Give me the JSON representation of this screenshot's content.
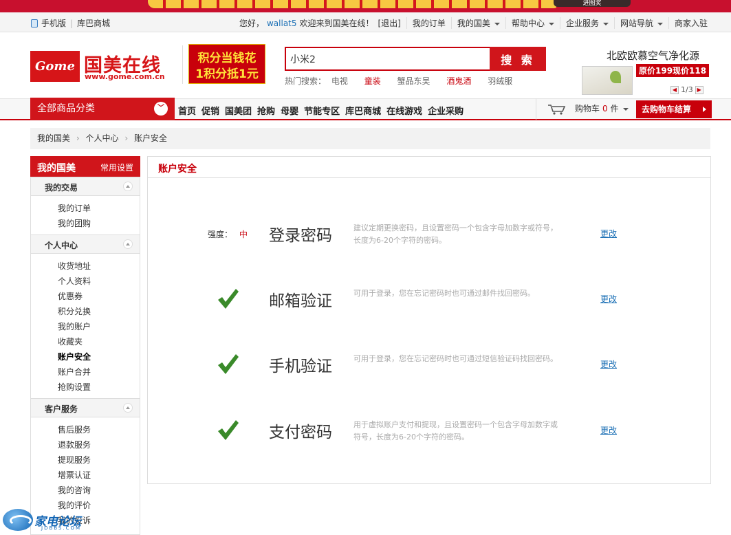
{
  "banner": {
    "button_label": "进图奖"
  },
  "topbar": {
    "mobile": "手机版",
    "coo8": "库巴商城",
    "greeting": "您好，",
    "username": "wallat5",
    "welcome": "欢迎来到国美在线！",
    "logout": "[退出]",
    "orders": "我的订单",
    "my_gome": "我的国美",
    "help": "帮助中心",
    "enterprise": "企业服务",
    "site_nav": "网站导航",
    "merchant": "商家入驻"
  },
  "header": {
    "logo_mark": "Gome",
    "logo_name": "国美在线",
    "logo_url": "www.gome.com.cn",
    "promo_line1": "积分当钱花",
    "promo_line2": "1积分抵1元",
    "search_value": "小米2",
    "search_button": "搜 索",
    "hot_label": "热门搜索：",
    "hot_terms": [
      "电视",
      "童装",
      "蟹品东吴",
      "酒鬼酒",
      "羽绒服"
    ],
    "ad_title": "北欧欧慕空气净化源",
    "ad_price": "原价199现价118",
    "ad_pager": "1/3"
  },
  "nav": {
    "all_categories": "全部商品分类",
    "links": [
      "首页",
      "促销",
      "国美团",
      "抢购",
      "母婴",
      "节能专区",
      "库巴商城",
      "在线游戏",
      "企业采购"
    ],
    "cart_label": "购物车",
    "cart_count": "0",
    "cart_unit": "件",
    "checkout": "去购物车结算"
  },
  "breadcrumb": [
    "我的国美",
    "个人中心",
    "账户安全"
  ],
  "sidebar": {
    "title": "我的国美",
    "settings": "常用设置",
    "groups": [
      {
        "title": "我的交易",
        "items": [
          "我的订单",
          "我的团购"
        ]
      },
      {
        "title": "个人中心",
        "items": [
          "收货地址",
          "个人资料",
          "优惠券",
          "积分兑换",
          "我的账户",
          "收藏夹",
          "账户安全",
          "账户合并",
          "抢购设置"
        ]
      },
      {
        "title": "客户服务",
        "items": [
          "售后服务",
          "退款服务",
          "提现服务",
          "增票认证",
          "我的咨询",
          "我的评价",
          "我的投诉"
        ]
      }
    ]
  },
  "main": {
    "title": "账户安全",
    "strength_label": "强度：",
    "strength_value": "中",
    "rows": [
      {
        "title": "登录密码",
        "desc": "建议定期更换密码，且设置密码一个包含字母加数字或符号，长度为6-20个字符的密码。",
        "action": "更改"
      },
      {
        "title": "邮箱验证",
        "desc": "可用于登录，您在忘记密码时也可通过邮件找回密码。",
        "action": "更改"
      },
      {
        "title": "手机验证",
        "desc": "可用于登录，您在忘记密码时也可通过短信验证码找回密码。",
        "action": "更改"
      },
      {
        "title": "支付密码",
        "desc": "用于虚拟账户支付和提现，且设置密码一个包含字母加数字或符号，长度为6-20个字符的密码。",
        "action": "更改"
      }
    ]
  },
  "watermark": {
    "big": "家电论坛",
    "small": "JDBBS.COM"
  },
  "colors": {
    "brand_red": "#c8000b",
    "link_blue": "#1a6fb5",
    "check_green": "#3a8a2a"
  }
}
